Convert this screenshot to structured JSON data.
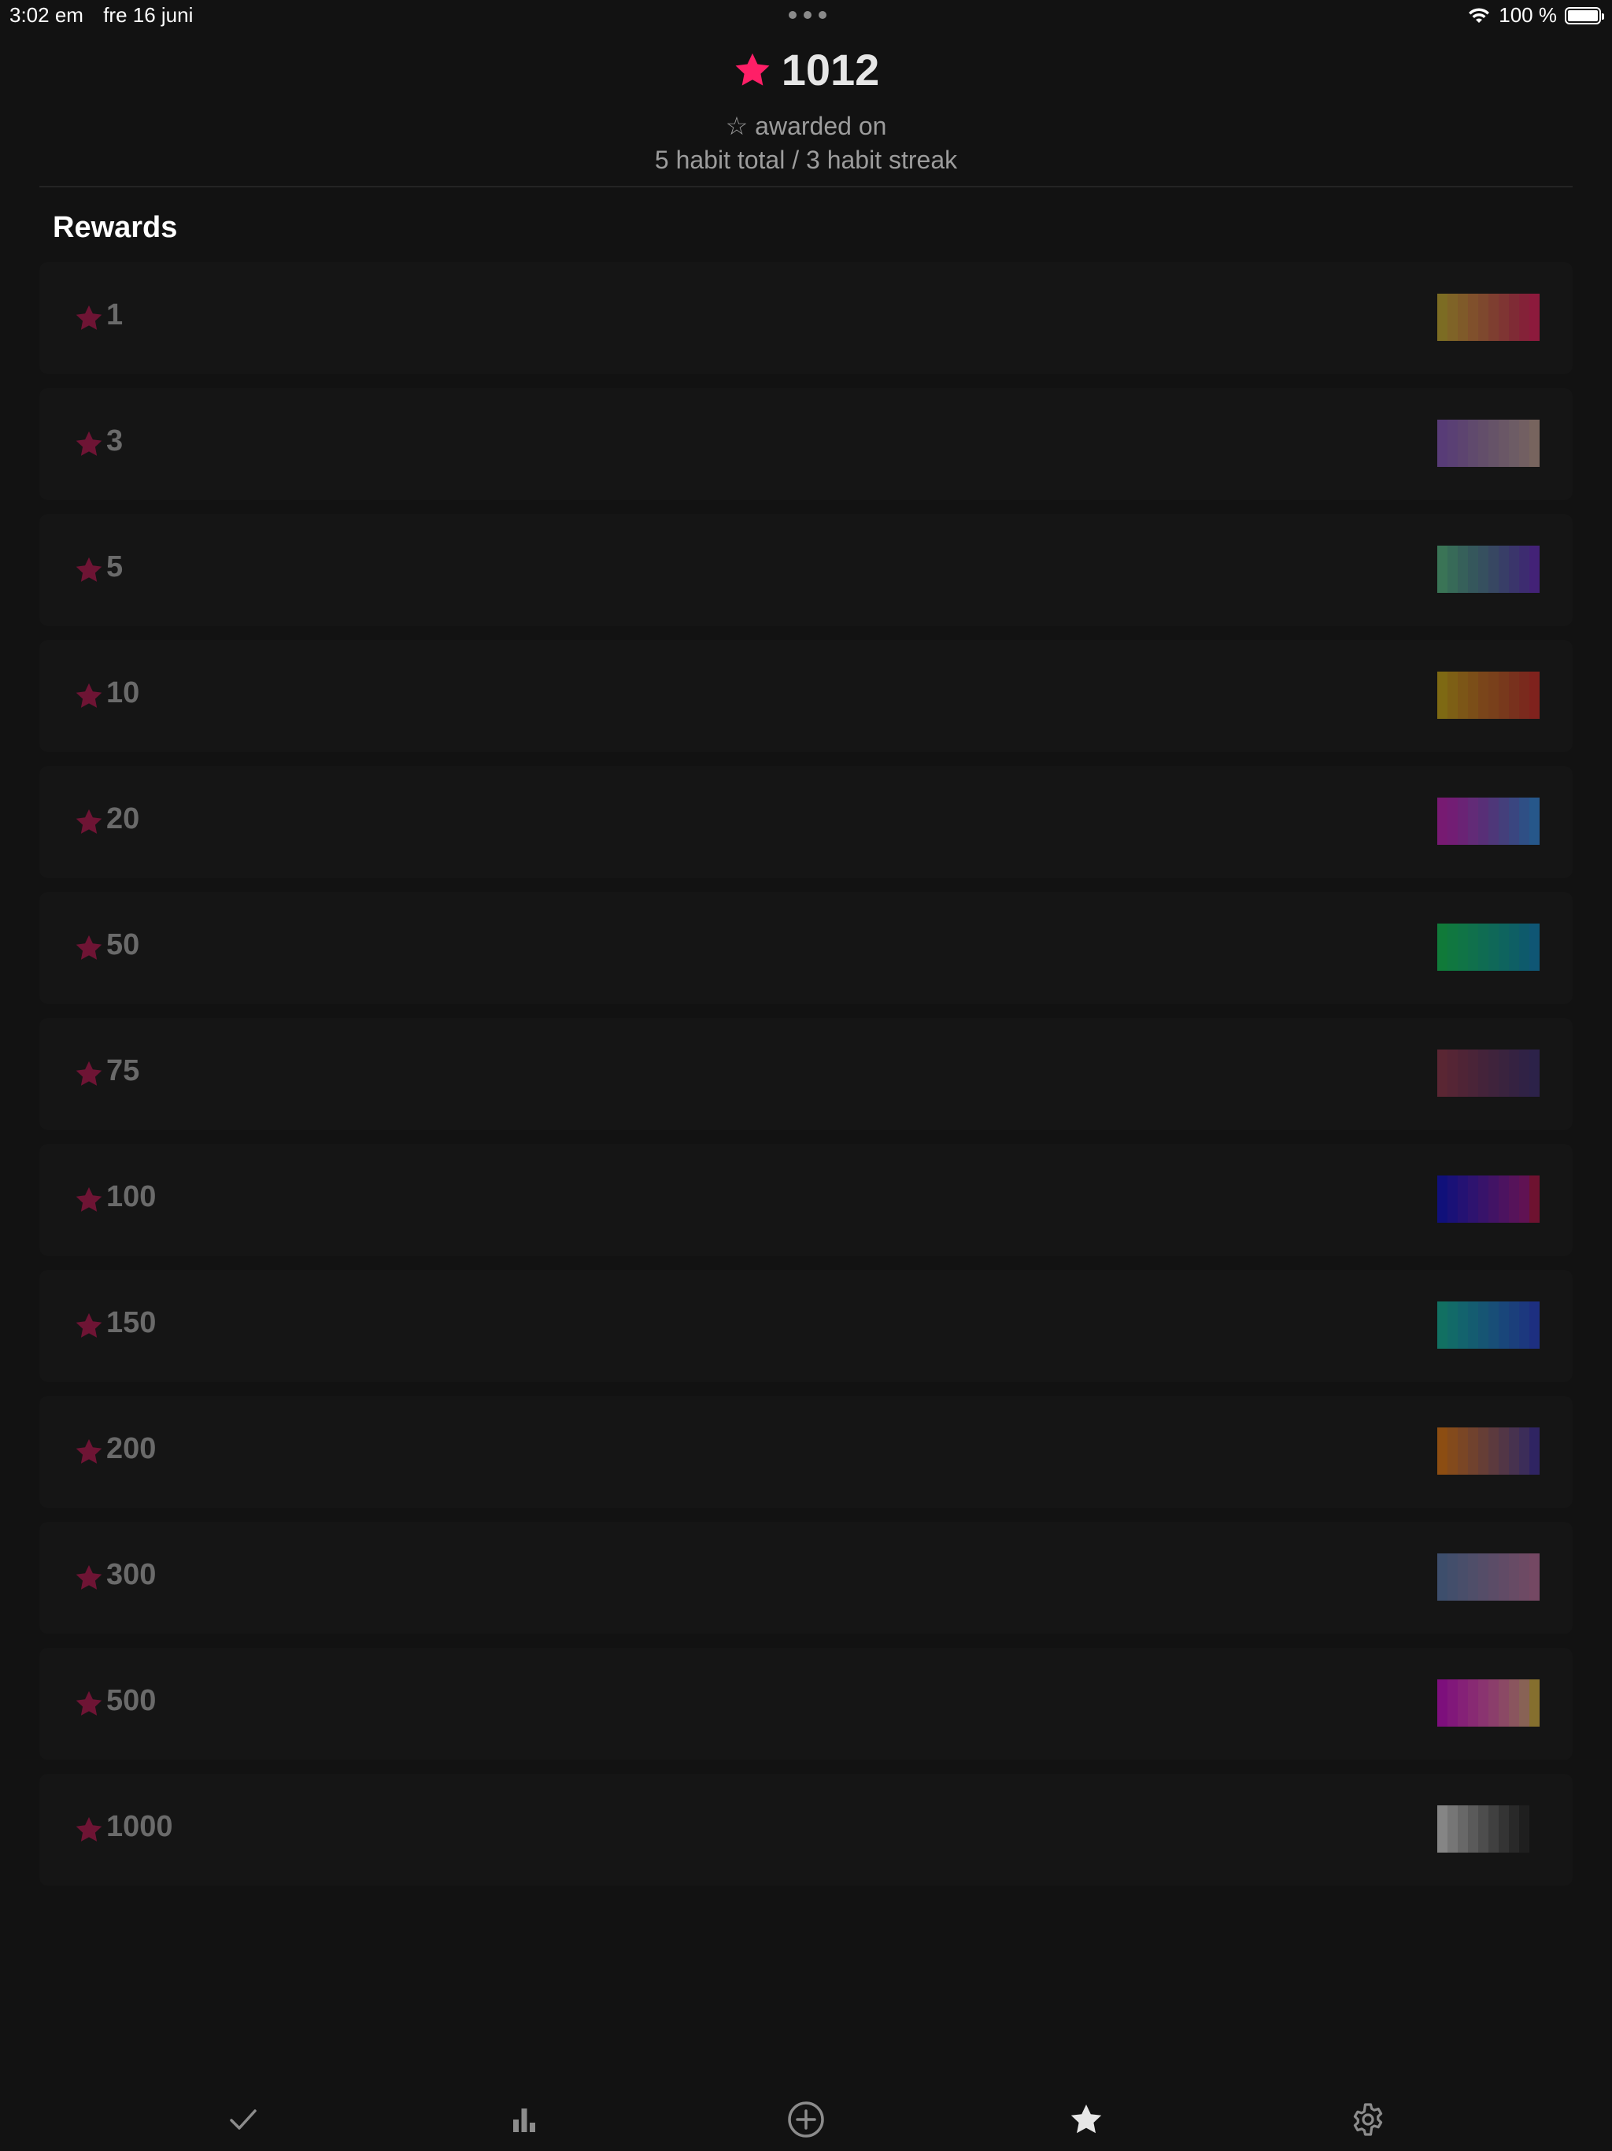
{
  "status_bar": {
    "time": "3:02 em",
    "date": "fre 16 juni",
    "battery": "100 %"
  },
  "header": {
    "total": "1012",
    "awarded_label": "☆ awarded on",
    "criteria": "5 habit total / 3 habit streak"
  },
  "section_title": "Rewards",
  "colors": {
    "accent": "#ff1f67",
    "star_dim": "#6e1434",
    "background": "#121212",
    "row": "#151515"
  },
  "rewards": [
    {
      "value": "1",
      "palette": [
        "#7c6c23",
        "#7f6327",
        "#7f5a29",
        "#80502c",
        "#7e482e",
        "#7e3e30",
        "#7f3533",
        "#7f2b35",
        "#842238",
        "#8c1a3c"
      ]
    },
    {
      "value": "3",
      "palette": [
        "#583c77",
        "#5a4074",
        "#5d4470",
        "#604a6d",
        "#634e6a",
        "#665368",
        "#6a5766",
        "#6d5c65",
        "#725f62",
        "#77645e"
      ]
    },
    {
      "value": "5",
      "palette": [
        "#3a7456",
        "#376a58",
        "#36605a",
        "#35575c",
        "#36505f",
        "#374762",
        "#383e67",
        "#3a356b",
        "#3d2c70",
        "#432277"
      ]
    },
    {
      "value": "10",
      "palette": [
        "#7e6913",
        "#7d5f15",
        "#7c5617",
        "#7b4e18",
        "#7a451a",
        "#79401b",
        "#78391c",
        "#78311d",
        "#7a2a1d",
        "#7f221d"
      ]
    },
    {
      "value": "20",
      "palette": [
        "#771a72",
        "#721d74",
        "#6a2375",
        "#622b77",
        "#582f77",
        "#4e3779",
        "#443f7b",
        "#3a4680",
        "#2f4f85",
        "#26578a"
      ]
    },
    {
      "value": "50",
      "palette": [
        "#107a39",
        "#107740",
        "#107446",
        "#10704c",
        "#0f6c52",
        "#0f6858",
        "#0e645e",
        "#0e5f64",
        "#0e5a6b",
        "#0f5674"
      ]
    },
    {
      "value": "75",
      "palette": [
        "#5a2633",
        "#552535",
        "#4f2436",
        "#4a2438",
        "#44233a",
        "#3f233c",
        "#3a233e",
        "#352241",
        "#302245",
        "#2c2249"
      ]
    },
    {
      "value": "100",
      "palette": [
        "#10107a",
        "#1a1177",
        "#241273",
        "#2e136f",
        "#38136a",
        "#421365",
        "#4c1360",
        "#56135a",
        "#601253",
        "#6e1230"
      ]
    },
    {
      "value": "150",
      "palette": [
        "#117062",
        "#126a68",
        "#13636d",
        "#145c70",
        "#165573",
        "#184e77",
        "#19467a",
        "#1b3f7b",
        "#1c387e",
        "#1d2f80"
      ]
    },
    {
      "value": "200",
      "palette": [
        "#8c4d12",
        "#834a1c",
        "#7a4625",
        "#70422e",
        "#663e36",
        "#5c3a3e",
        "#523646",
        "#47324f",
        "#3c2d59",
        "#2f2462"
      ]
    },
    {
      "value": "300",
      "palette": [
        "#3d4e6c",
        "#434e6b",
        "#494e6a",
        "#4f4e69",
        "#554d68",
        "#5b4c67",
        "#614b66",
        "#674b65",
        "#6d4a64",
        "#744863"
      ]
    },
    {
      "value": "500",
      "palette": [
        "#7d0f7c",
        "#81187a",
        "#852177",
        "#882a73",
        "#8a3470",
        "#8b3e6b",
        "#8b4965",
        "#8a555e",
        "#886255",
        "#856f2e"
      ]
    },
    {
      "value": "1000",
      "palette": [
        "#858585",
        "#767676",
        "#686868",
        "#5a5a5a",
        "#4d4d4d",
        "#404040",
        "#343434",
        "#292929",
        "#1f1f1f",
        "#151515"
      ]
    }
  ],
  "tab_bar": {
    "tabs": [
      {
        "name": "checkmark-icon"
      },
      {
        "name": "bar-chart-icon"
      },
      {
        "name": "add-circle-icon"
      },
      {
        "name": "star-icon"
      },
      {
        "name": "gear-icon"
      }
    ]
  }
}
